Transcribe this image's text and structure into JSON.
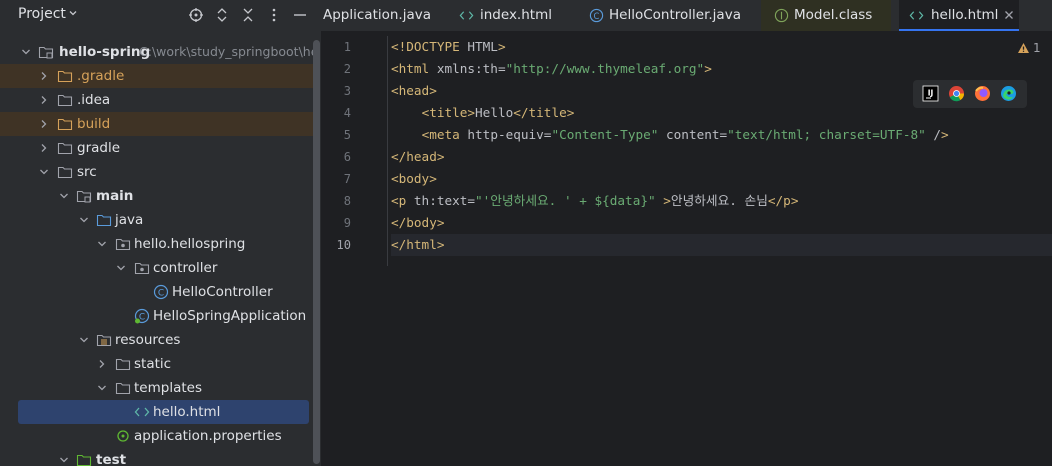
{
  "project": {
    "title": "Project",
    "tree": [
      {
        "label": "hello-spring",
        "path": "C:\\work\\study_springboot\\he",
        "bold": true
      },
      {
        "label": ".gradle"
      },
      {
        "label": ".idea"
      },
      {
        "label": "build"
      },
      {
        "label": "gradle"
      },
      {
        "label": "src"
      },
      {
        "label": "main",
        "bold": true
      },
      {
        "label": "java"
      },
      {
        "label": "hello.hellospring"
      },
      {
        "label": "controller"
      },
      {
        "label": "HelloController"
      },
      {
        "label": "HelloSpringApplication"
      },
      {
        "label": "resources"
      },
      {
        "label": "static"
      },
      {
        "label": "templates"
      },
      {
        "label": "hello.html"
      },
      {
        "label": "application.properties"
      },
      {
        "label": "test",
        "bold": true
      }
    ]
  },
  "tabs": [
    {
      "label": "Application.java"
    },
    {
      "label": "index.html"
    },
    {
      "label": "HelloController.java"
    },
    {
      "label": "Model.class"
    },
    {
      "label": "hello.html",
      "active": true
    }
  ],
  "editor": {
    "warning_count": "1",
    "line_numbers": [
      "1",
      "2",
      "3",
      "4",
      "5",
      "6",
      "7",
      "8",
      "9",
      "10"
    ],
    "lines": [
      "<!DOCTYPE HTML>",
      "<html xmlns:th=\"http://www.thymeleaf.org\">",
      "<head>",
      "    <title>Hello</title>",
      "    <meta http-equiv=\"Content-Type\" content=\"text/html; charset=UTF-8\" />",
      "</head>",
      "<body>",
      "<p th:text=\"'안녕하세요. ' + ${data}\" >안녕하세요. 손님</p>",
      "</body>",
      "</html>"
    ],
    "browser_icons": [
      "intellij-icon",
      "chrome-icon",
      "firefox-icon",
      "edge-icon"
    ]
  },
  "colors": {
    "tag": "#d5b778",
    "string": "#6aab73",
    "selection": "#2e436e",
    "excluded_folder": "#3f3325",
    "active_tab_underline": "#3574f0"
  }
}
